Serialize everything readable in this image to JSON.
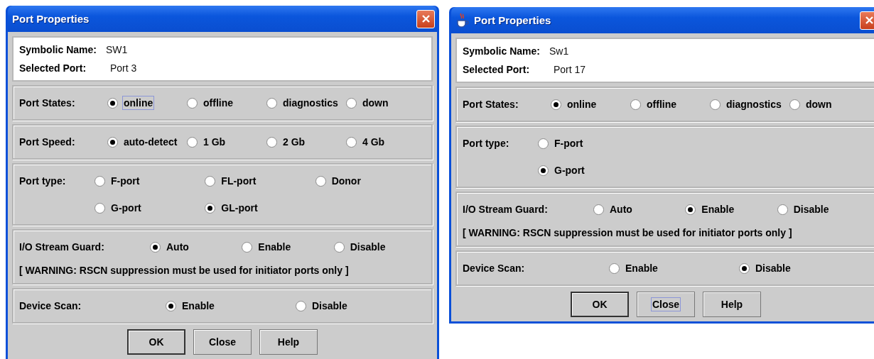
{
  "dialogs": [
    {
      "title": "Port Properties",
      "app_icon": false,
      "info": [
        {
          "label": "Symbolic Name:",
          "value": "SW1"
        },
        {
          "label": "Selected Port:",
          "value": "Port 3"
        }
      ],
      "groups": [
        {
          "kind": "states",
          "label": "Port States:",
          "rows": [
            [
              {
                "label": "online",
                "selected": true,
                "focused": true
              },
              {
                "label": "offline",
                "selected": false,
                "focused": false
              },
              {
                "label": "diagnostics",
                "selected": false,
                "focused": false
              },
              {
                "label": "down",
                "selected": false,
                "focused": false
              }
            ]
          ]
        },
        {
          "kind": "speed",
          "label": "Port Speed:",
          "rows": [
            [
              {
                "label": "auto-detect",
                "selected": true,
                "focused": false
              },
              {
                "label": "1 Gb",
                "selected": false,
                "focused": false
              },
              {
                "label": "2 Gb",
                "selected": false,
                "focused": false
              },
              {
                "label": "4 Gb",
                "selected": false,
                "focused": false
              }
            ]
          ]
        },
        {
          "kind": "type",
          "label": "Port type:",
          "rows": [
            [
              {
                "label": "F-port",
                "selected": false,
                "focused": false
              },
              {
                "label": "FL-port",
                "selected": false,
                "focused": false
              },
              {
                "label": "Donor",
                "selected": false,
                "focused": false
              }
            ],
            [
              {
                "label": "G-port",
                "selected": false,
                "focused": false
              },
              {
                "label": "GL-port",
                "selected": true,
                "focused": false
              }
            ]
          ]
        },
        {
          "kind": "guard",
          "label": "I/O Stream Guard:",
          "rows": [
            [
              {
                "label": "Auto",
                "selected": true,
                "focused": false
              },
              {
                "label": "Enable",
                "selected": false,
                "focused": false
              },
              {
                "label": "Disable",
                "selected": false,
                "focused": false
              }
            ]
          ],
          "note": "[ WARNING: RSCN suppression must be used for initiator ports only ]"
        },
        {
          "kind": "scan",
          "label": "Device Scan:",
          "rows": [
            [
              {
                "label": "Enable",
                "selected": true,
                "focused": false
              },
              {
                "label": "Disable",
                "selected": false,
                "focused": false
              }
            ]
          ]
        }
      ],
      "buttons": [
        {
          "label": "OK",
          "default": true,
          "focused": false
        },
        {
          "label": "Close",
          "default": false,
          "focused": false
        },
        {
          "label": "Help",
          "default": false,
          "focused": false
        }
      ]
    },
    {
      "title": "Port Properties",
      "app_icon": true,
      "info": [
        {
          "label": "Symbolic Name:",
          "value": "Sw1"
        },
        {
          "label": "Selected Port:",
          "value": "Port 17"
        }
      ],
      "groups": [
        {
          "kind": "states",
          "label": "Port States:",
          "rows": [
            [
              {
                "label": "online",
                "selected": true,
                "focused": false
              },
              {
                "label": "offline",
                "selected": false,
                "focused": false
              },
              {
                "label": "diagnostics",
                "selected": false,
                "focused": false
              },
              {
                "label": "down",
                "selected": false,
                "focused": false
              }
            ]
          ]
        },
        {
          "kind": "type",
          "label": "Port type:",
          "rows": [
            [
              {
                "label": "F-port",
                "selected": false,
                "focused": false
              }
            ],
            [
              {
                "label": "G-port",
                "selected": true,
                "focused": false
              }
            ]
          ]
        },
        {
          "kind": "guard",
          "label": "I/O Stream Guard:",
          "rows": [
            [
              {
                "label": "Auto",
                "selected": false,
                "focused": false
              },
              {
                "label": "Enable",
                "selected": true,
                "focused": false
              },
              {
                "label": "Disable",
                "selected": false,
                "focused": false
              }
            ]
          ],
          "note": "[ WARNING: RSCN suppression must be used for initiator ports only ]"
        },
        {
          "kind": "scan",
          "label": "Device Scan:",
          "rows": [
            [
              {
                "label": "Enable",
                "selected": false,
                "focused": false
              },
              {
                "label": "Disable",
                "selected": true,
                "focused": false
              }
            ]
          ]
        }
      ],
      "buttons": [
        {
          "label": "OK",
          "default": true,
          "focused": false
        },
        {
          "label": "Close",
          "default": false,
          "focused": true
        },
        {
          "label": "Help",
          "default": false,
          "focused": false
        }
      ]
    }
  ]
}
